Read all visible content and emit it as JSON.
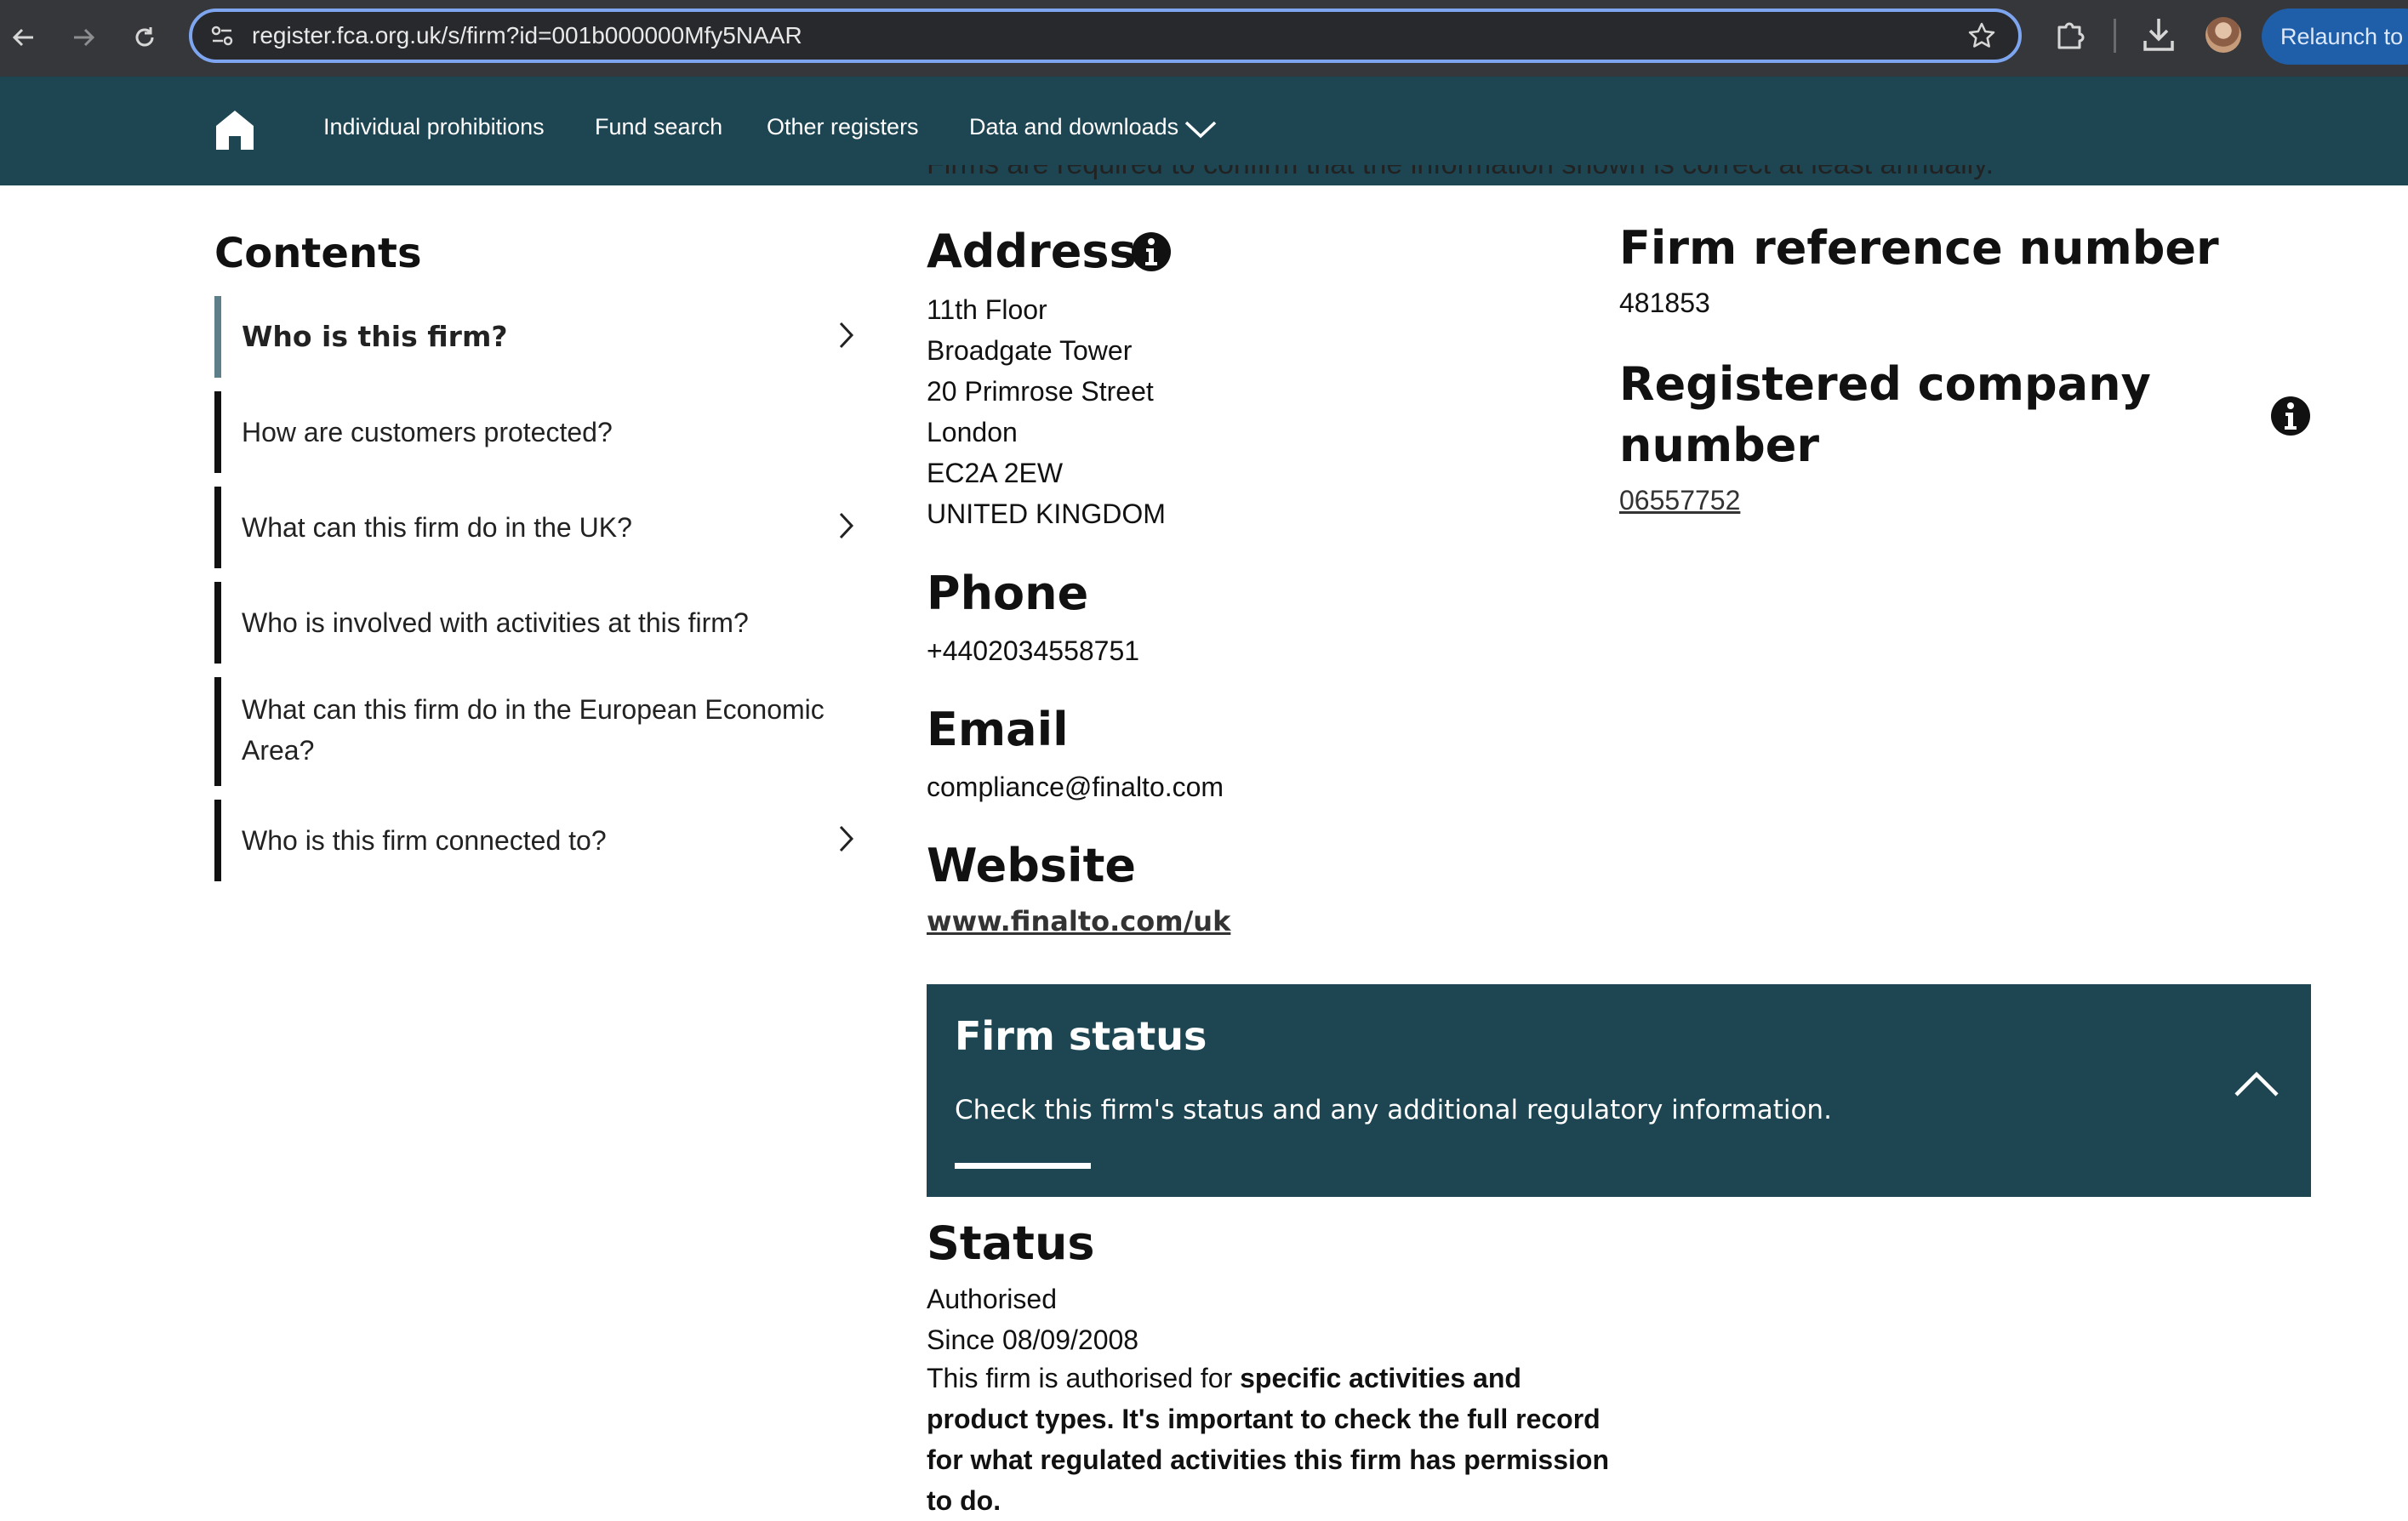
{
  "browser": {
    "url": "register.fca.org.uk/s/firm?id=001b000000Mfy5NAAR",
    "relaunch_label": "Relaunch to"
  },
  "nav": {
    "items": [
      "Individual prohibitions",
      "Fund search",
      "Other registers",
      "Data and downloads"
    ]
  },
  "intro_cutoff": "Firms are required to confirm that the information shown is correct at least annually.",
  "contents": {
    "title": "Contents",
    "items": [
      {
        "label": "Who is this firm?",
        "active": true,
        "arrow": true
      },
      {
        "label": "How are customers protected?",
        "arrow": false
      },
      {
        "label": "What can this firm do in the UK?",
        "arrow": true
      },
      {
        "label": "Who is involved with activities at this firm?",
        "arrow": false
      },
      {
        "label": "What can this firm do in the European Economic Area?",
        "arrow": false
      },
      {
        "label": "Who is this firm connected to?",
        "arrow": true
      }
    ]
  },
  "address": {
    "heading": "Address",
    "lines": [
      "11th Floor",
      "Broadgate Tower",
      "20 Primrose Street",
      "London",
      "EC2A 2EW",
      "UNITED KINGDOM"
    ]
  },
  "phone": {
    "heading": "Phone",
    "value": "+4402034558751"
  },
  "email": {
    "heading": "Email",
    "value": "compliance@finalto.com"
  },
  "website": {
    "heading": "Website",
    "value": "www.finalto.com/uk"
  },
  "frn": {
    "heading": "Firm reference number",
    "value": "481853"
  },
  "company": {
    "heading_line1": "Registered company",
    "heading_line2": "number",
    "value": "06557752"
  },
  "firm_status_panel": {
    "title": "Firm status",
    "subtitle": "Check this firm's status and any additional regulatory information."
  },
  "status": {
    "heading": "Status",
    "value": "Authorised",
    "since": "Since 08/09/2008",
    "text_plain": "This firm is authorised for ",
    "text_bold": "specific activities and product types. It's important to check the full record for what regulated activities this firm has permission to do."
  }
}
